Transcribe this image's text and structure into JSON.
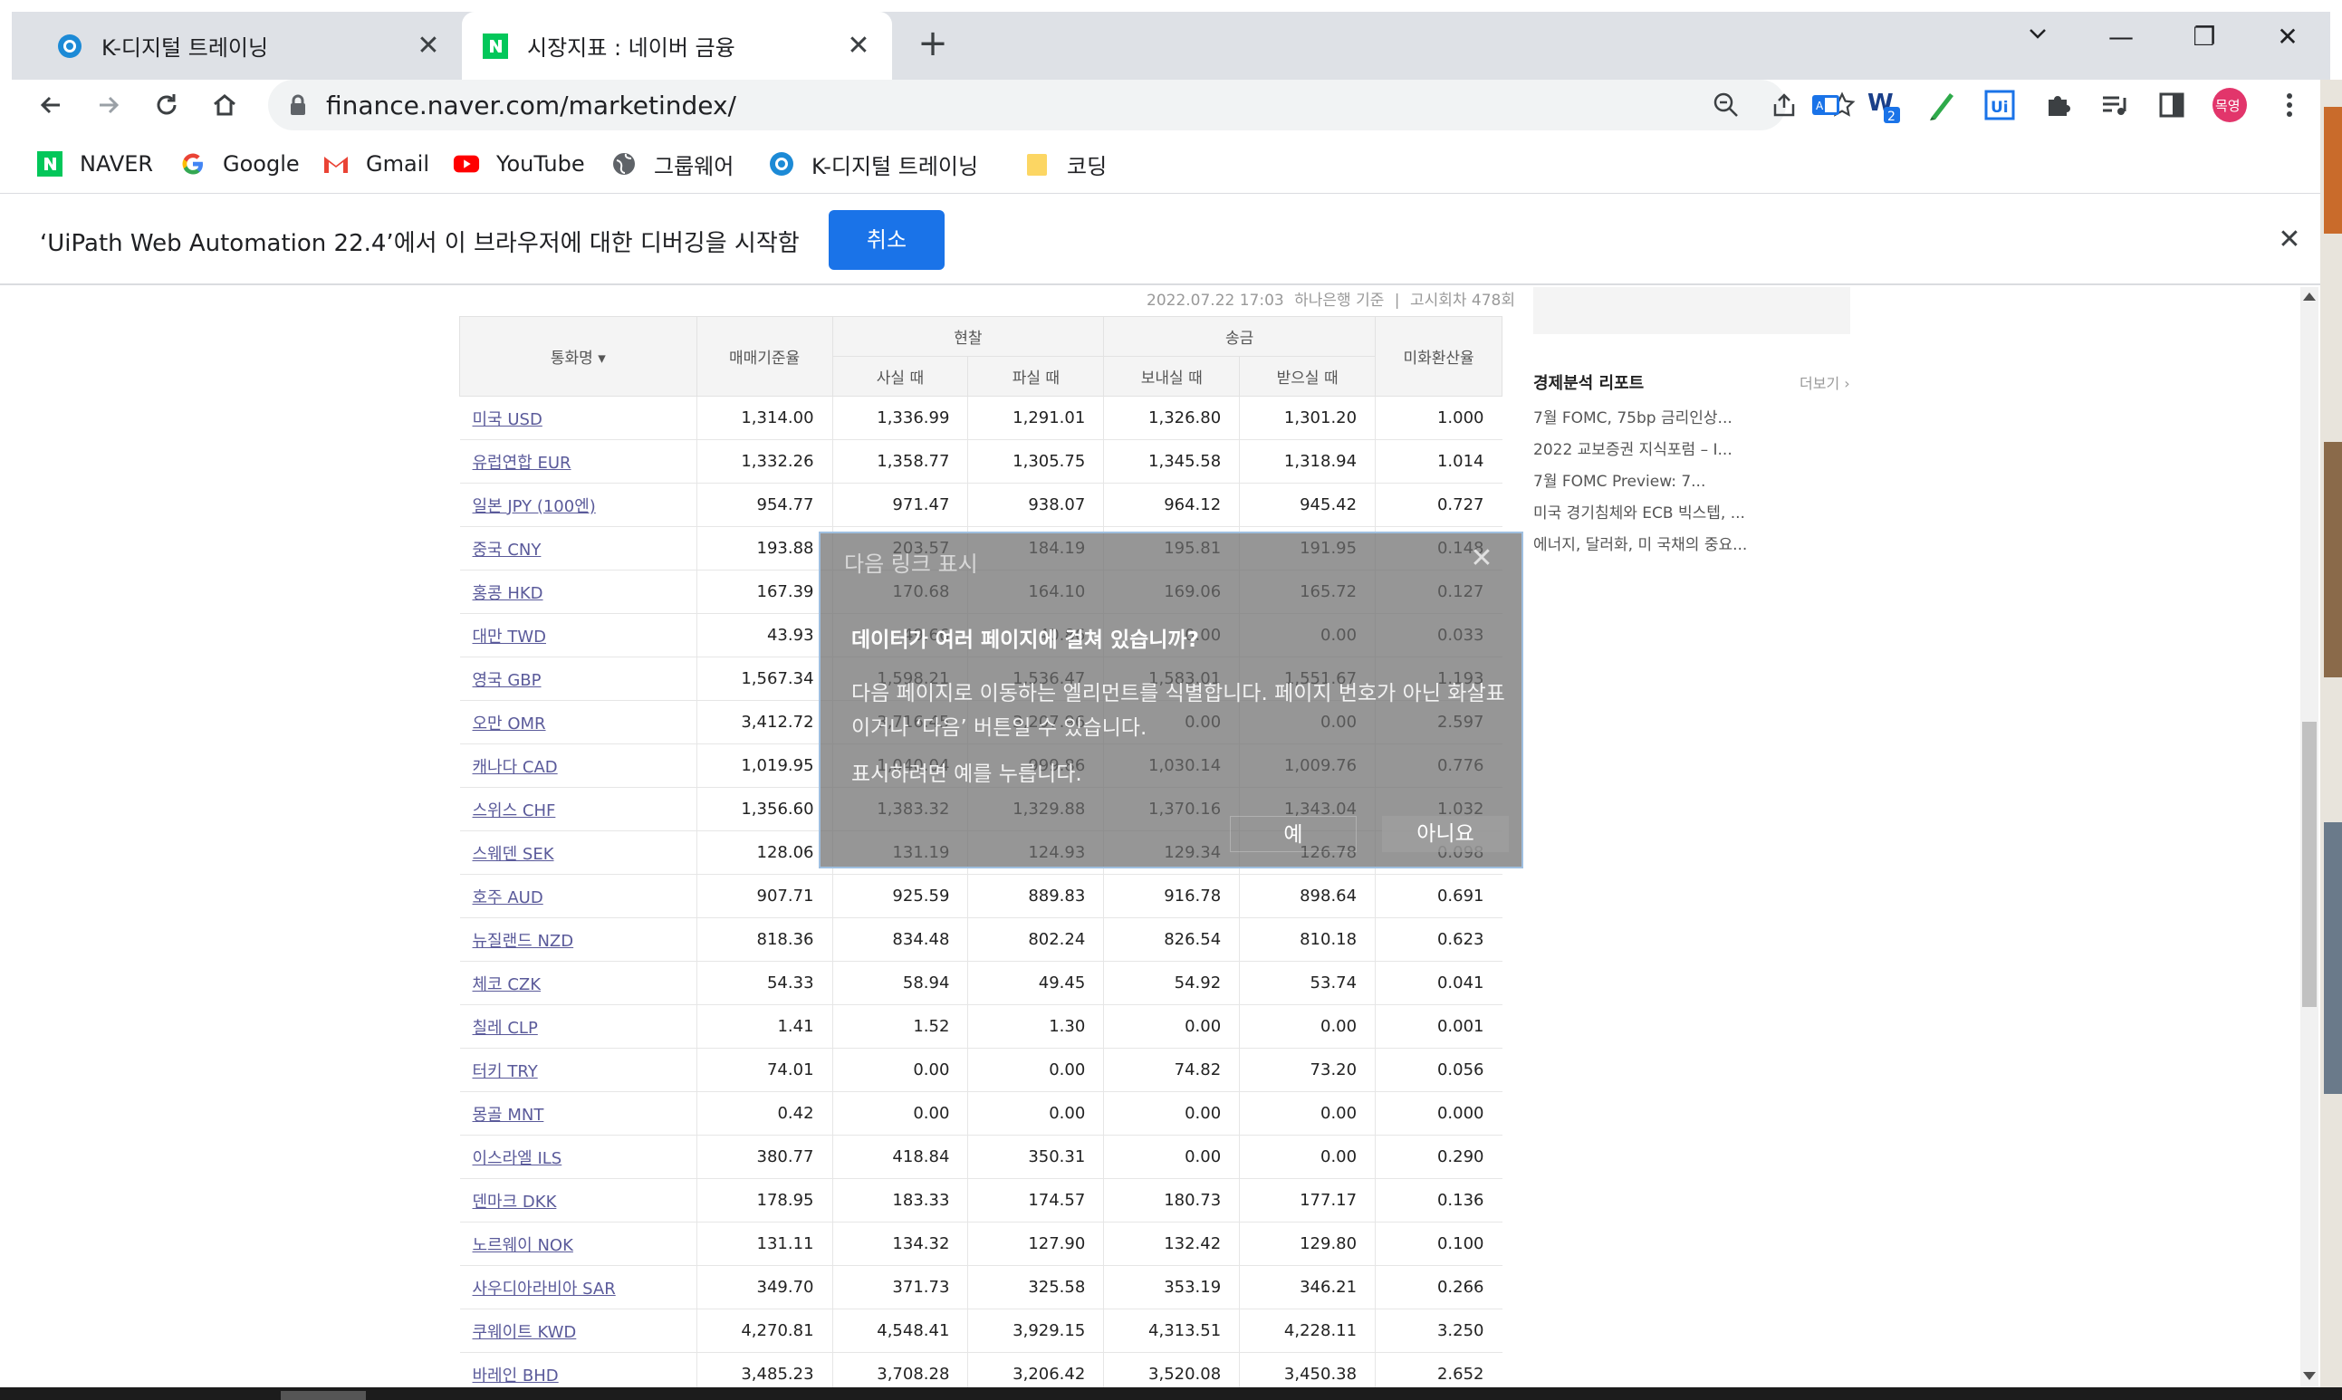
{
  "tabs": [
    {
      "title": "K-디지털 트레이닝",
      "favicon": "k-digital-icon"
    },
    {
      "title": "시장지표 : 네이버 금융",
      "favicon": "naver-icon"
    }
  ],
  "window_controls": {
    "list": "⌄",
    "minimize": "—",
    "restore": "❐",
    "close": "✕"
  },
  "newtab_label": "+",
  "address": {
    "url": "finance.naver.com/marketindex/"
  },
  "profile": {
    "label": "목영",
    "color": "#e2356b"
  },
  "extension_badge": "2",
  "bookmarks": [
    {
      "label": "NAVER",
      "icon": "naver-icon"
    },
    {
      "label": "Google",
      "icon": "google-icon"
    },
    {
      "label": "Gmail",
      "icon": "gmail-icon"
    },
    {
      "label": "YouTube",
      "icon": "youtube-icon"
    },
    {
      "label": "그룹웨어",
      "icon": "globe-icon"
    },
    {
      "label": "K-디지털 트레이닝",
      "icon": "k-digital-icon"
    },
    {
      "label": "코딩",
      "icon": "folder-icon"
    }
  ],
  "infobar": {
    "message": "‘UiPath Web Automation 22.4’에서 이 브라우저에 대한 디버깅을 시작함",
    "cancel": "취소",
    "close": "✕"
  },
  "stamp": {
    "date": "2022.07.22 17:03",
    "source": "하나은행 기준",
    "round": "고시회차 478회"
  },
  "table": {
    "headers": {
      "currency": "통화명",
      "base": "매매기준율",
      "cash": "현찰",
      "transfer": "송금",
      "cash_buy": "사실 때",
      "cash_sell": "파실 때",
      "send": "보내실 때",
      "receive": "받으실 때",
      "usd_ratio": "미화환산율"
    },
    "rows": [
      [
        "미국 USD",
        "1,314.00",
        "1,336.99",
        "1,291.01",
        "1,326.80",
        "1,301.20",
        "1.000"
      ],
      [
        "유럽연합 EUR",
        "1,332.26",
        "1,358.77",
        "1,305.75",
        "1,345.58",
        "1,318.94",
        "1.014"
      ],
      [
        "일본 JPY (100엔)",
        "954.77",
        "971.47",
        "938.07",
        "964.12",
        "945.42",
        "0.727"
      ],
      [
        "중국 CNY",
        "193.88",
        "203.57",
        "184.19",
        "195.81",
        "191.95",
        "0.148"
      ],
      [
        "홍콩 HKD",
        "167.39",
        "170.68",
        "164.10",
        "169.06",
        "165.72",
        "0.127"
      ],
      [
        "대만 TWD",
        "43.93",
        "49.66",
        "40.86",
        "0.00",
        "0.00",
        "0.033"
      ],
      [
        "영국 GBP",
        "1,567.34",
        "1,598.21",
        "1,536.47",
        "1,583.01",
        "1,551.67",
        "1.193"
      ],
      [
        "오만 OMR",
        "3,412.72",
        "3,716.45",
        "3,207.96",
        "0.00",
        "0.00",
        "2.597"
      ],
      [
        "캐나다 CAD",
        "1,019.95",
        "1,040.04",
        "999.86",
        "1,030.14",
        "1,009.76",
        "0.776"
      ],
      [
        "스위스 CHF",
        "1,356.60",
        "1,383.32",
        "1,329.88",
        "1,370.16",
        "1,343.04",
        "1.032"
      ],
      [
        "스웨덴 SEK",
        "128.06",
        "131.19",
        "124.93",
        "129.34",
        "126.78",
        "0.098"
      ],
      [
        "호주 AUD",
        "907.71",
        "925.59",
        "889.83",
        "916.78",
        "898.64",
        "0.691"
      ],
      [
        "뉴질랜드 NZD",
        "818.36",
        "834.48",
        "802.24",
        "826.54",
        "810.18",
        "0.623"
      ],
      [
        "체코 CZK",
        "54.33",
        "58.94",
        "49.45",
        "54.92",
        "53.74",
        "0.041"
      ],
      [
        "칠레 CLP",
        "1.41",
        "1.52",
        "1.30",
        "0.00",
        "0.00",
        "0.001"
      ],
      [
        "터키 TRY",
        "74.01",
        "0.00",
        "0.00",
        "74.82",
        "73.20",
        "0.056"
      ],
      [
        "몽골 MNT",
        "0.42",
        "0.00",
        "0.00",
        "0.00",
        "0.00",
        "0.000"
      ],
      [
        "이스라엘 ILS",
        "380.77",
        "418.84",
        "350.31",
        "0.00",
        "0.00",
        "0.290"
      ],
      [
        "덴마크 DKK",
        "178.95",
        "183.33",
        "174.57",
        "180.73",
        "177.17",
        "0.136"
      ],
      [
        "노르웨이 NOK",
        "131.11",
        "134.32",
        "127.90",
        "132.42",
        "129.80",
        "0.100"
      ],
      [
        "사우디아라비아 SAR",
        "349.70",
        "371.73",
        "325.58",
        "353.19",
        "346.21",
        "0.266"
      ],
      [
        "쿠웨이트 KWD",
        "4,270.81",
        "4,548.41",
        "3,929.15",
        "4,313.51",
        "4,228.11",
        "3.250"
      ],
      [
        "바레인 BHD",
        "3,485.23",
        "3,708.28",
        "3,206.42",
        "3,520.08",
        "3,450.38",
        "2.652"
      ]
    ]
  },
  "sidebar": {
    "title": "경제분석 리포트",
    "more": "더보기",
    "items": [
      "7월 FOMC, 75bp 금리인상...",
      "2022 교보증권 지식포럼 – I...",
      "7월 FOMC Preview: 7...",
      "미국 경기침체와 ECB 빅스텝, ...",
      "에너지, 달러화, 미 국채의 중요..."
    ]
  },
  "overlay": {
    "title": "다음 링크 표시",
    "heading": "데이터가 여러 페이지에 걸쳐 있습니까?",
    "body": "다음 페이지로 이동하는 엘리먼트를 식별합니다. 페이지 번호가 아닌 화살표이거나 ‘다음’ 버튼일 수 있습니다.",
    "hint": "표시하려면 예를 누릅니다.",
    "yes": "예",
    "no": "아니요",
    "close": "✕"
  }
}
